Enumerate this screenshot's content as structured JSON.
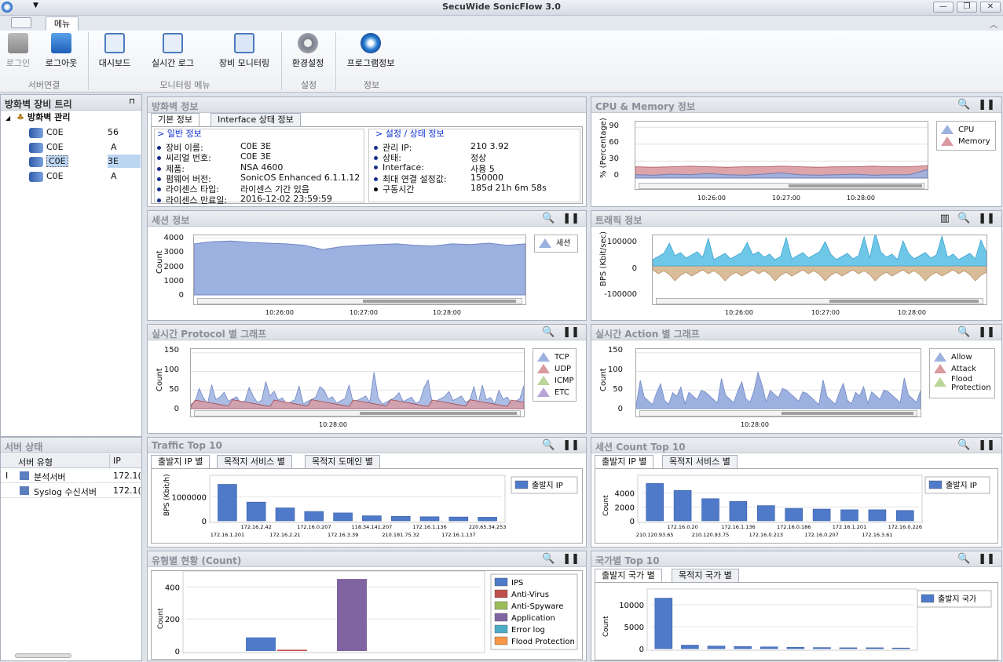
{
  "app": {
    "title": "SecuWide SonicFlow 3.0",
    "menu_tab": "메뉴"
  },
  "ribbon": {
    "buttons": [
      {
        "label": "로그인",
        "icon": "lock-gray-icon"
      },
      {
        "label": "로그아웃",
        "icon": "lock-blue-icon"
      },
      {
        "label": "대시보드",
        "icon": "dashboard-icon"
      },
      {
        "label": "실시간 로그",
        "icon": "chart-monitor-icon"
      },
      {
        "label": "장비 모니터링",
        "icon": "device-icon"
      },
      {
        "label": "환경설정",
        "icon": "gear-icon"
      },
      {
        "label": "프로그램정보",
        "icon": "info-globe-icon"
      }
    ],
    "groups": [
      "서버연결",
      "모니터링 메뉴",
      "설정",
      "정보"
    ]
  },
  "tree": {
    "title": "방화벽 장비 트리",
    "root": "방화벽 관리",
    "items": [
      {
        "name": "C0E",
        "suffix": "56"
      },
      {
        "name": "C0E",
        "suffix": "A"
      },
      {
        "name": "C0E",
        "suffix": "3E"
      },
      {
        "name": "C0E",
        "suffix": "A"
      }
    ]
  },
  "server_status": {
    "title": "서버 상태",
    "columns": [
      "서버 유형",
      "IP"
    ],
    "rows": [
      {
        "marker": "I",
        "type": "분석서버",
        "ip": "172.1("
      },
      {
        "marker": "",
        "type": "Syslog 수신서버",
        "ip": "172.1("
      }
    ]
  },
  "fw_info": {
    "title": "방화벽 정보",
    "tabs": [
      "기본 정보",
      "Interface 상태 정보"
    ],
    "general": {
      "heading": "> 일반 정보",
      "rows": [
        {
          "k": "장비 이름:",
          "v": "C0E      3E"
        },
        {
          "k": "씨리얼 번호:",
          "v": "C0E      3E"
        },
        {
          "k": "제품:",
          "v": "NSA 4600"
        },
        {
          "k": "펌웨어 버전:",
          "v": "SonicOS Enhanced 6.1.1.12"
        },
        {
          "k": "라이센스 타입:",
          "v": "라이센스 기간 있음"
        },
        {
          "k": "라이센스 만료일:",
          "v": "2016-12-02 23:59:59"
        }
      ]
    },
    "status": {
      "heading": "> 설정 / 상태 정보",
      "rows": [
        {
          "k": "관리 IP:",
          "v": "210       3.92"
        },
        {
          "k": "상태:",
          "v": "정상"
        },
        {
          "k": "Interface:",
          "v": "사용 5"
        },
        {
          "k": "최대 연결 설정값:",
          "v": "150000"
        },
        {
          "k": "구동시간",
          "v": "185d 21h 6m 58s"
        }
      ]
    }
  },
  "panels": {
    "cpu": "CPU & Memory 정보",
    "session": "세션 정보",
    "traffic": "트래픽 정보",
    "protocol": "실시간 Protocol 별 그래프",
    "action": "실시간 Action 별 그래프",
    "traffic_top": "Traffic Top 10",
    "session_top": "세션 Count Top 10",
    "type_count": "유형별 현황 (Count)",
    "country_top": "국가별 Top 10"
  },
  "time_labels": [
    "10:26:00",
    "10:27:00",
    "10:28:00"
  ],
  "chart_data": [
    {
      "id": "cpu",
      "type": "area",
      "ylabel": "% (Percentage)",
      "yticks": [
        "90",
        "60",
        "30",
        "0"
      ],
      "ylim": [
        0,
        100
      ],
      "legend": [
        {
          "name": "CPU",
          "color": "#9db1e0"
        },
        {
          "name": "Memory",
          "color": "#d99aa0"
        }
      ],
      "series": [
        {
          "name": "Memory",
          "values": [
            20,
            19,
            20,
            21,
            20,
            19,
            20,
            20,
            21,
            20,
            19,
            20,
            20,
            21,
            20,
            20,
            22
          ]
        },
        {
          "name": "CPU",
          "values": [
            6,
            5,
            7,
            6,
            8,
            6,
            5,
            7,
            9,
            6,
            5,
            6,
            7,
            5,
            6,
            6,
            15
          ]
        }
      ]
    },
    {
      "id": "session",
      "type": "area",
      "ylabel": "Count",
      "yticks": [
        "4000",
        "3000",
        "2000",
        "1000",
        "0"
      ],
      "ylim": [
        0,
        4200
      ],
      "legend": [
        {
          "name": "세션",
          "color": "#9db1e0"
        }
      ],
      "series": [
        {
          "name": "세션",
          "values": [
            3600,
            3750,
            3800,
            3700,
            3650,
            3600,
            3500,
            3200,
            3400,
            3500,
            3550,
            3600,
            3500,
            3450,
            3600,
            3550,
            3650,
            3500,
            3600
          ]
        }
      ]
    },
    {
      "id": "traffic",
      "type": "area",
      "ylabel": "BPS (Kbit/sec)",
      "yticks": [
        "100000",
        "0",
        "-100000"
      ],
      "ylim": [
        -130000,
        130000
      ]
    },
    {
      "id": "protocol",
      "type": "area",
      "ylabel": "Count",
      "yticks": [
        "150",
        "100",
        "50",
        "0"
      ],
      "ylim": [
        0,
        160
      ],
      "legend": [
        {
          "name": "TCP",
          "color": "#9db1e0"
        },
        {
          "name": "UDP",
          "color": "#d99aa0"
        },
        {
          "name": "ICMP",
          "color": "#bcd59a"
        },
        {
          "name": "ETC",
          "color": "#b7a4d6"
        }
      ]
    },
    {
      "id": "action",
      "type": "area",
      "ylabel": "Count",
      "yticks": [
        "150",
        "100",
        "50",
        "0"
      ],
      "ylim": [
        0,
        160
      ],
      "legend": [
        {
          "name": "Allow",
          "color": "#9db1e0"
        },
        {
          "name": "Attack",
          "color": "#d99aa0"
        },
        {
          "name": "Flood Protection",
          "color": "#bcd59a"
        }
      ]
    },
    {
      "id": "traffic_top",
      "type": "bar",
      "tabs": [
        "출발지 IP 별",
        "목적지 서비스 별",
        "목적지 도메인 별"
      ],
      "ylabel": "BPS (Kbit/h)",
      "yticks": [
        "1000000",
        "0"
      ],
      "ylim": [
        0,
        1700000
      ],
      "legend": [
        {
          "name": "출발지 IP",
          "color": "#4f79c9"
        }
      ],
      "categories": [
        "172.16.1.201",
        "172.16.2.42",
        "172.16.2.21",
        "172.16.0.207",
        "172.16.3.39",
        "118.34.141.207",
        "210.181.75.32",
        "172.16.1.136",
        "172.16.1.137",
        "220.65.34.253"
      ],
      "values": [
        1520000,
        780000,
        540000,
        390000,
        330000,
        210000,
        190000,
        170000,
        160000,
        150000
      ]
    },
    {
      "id": "session_top",
      "type": "bar",
      "tabs": [
        "출발지 IP 별",
        "목적지 서비스 별"
      ],
      "ylabel": "Count",
      "yticks": [
        "4000",
        "2000",
        "0"
      ],
      "ylim": [
        0,
        5900
      ],
      "legend": [
        {
          "name": "출발지 IP",
          "color": "#4f79c9"
        }
      ],
      "categories": [
        "210.120.93.65",
        "172.16.0.20",
        "210.120.93.75",
        "172.16.1.136",
        "172.16.0.213",
        "172.16.0.186",
        "172.16.0.207",
        "172.16.1.201",
        "172.16.3.61",
        "172.16.0.226"
      ],
      "values": [
        5400,
        4400,
        3200,
        2800,
        2200,
        1800,
        1700,
        1600,
        1600,
        1500
      ]
    },
    {
      "id": "type_count",
      "type": "bar",
      "ylabel": "Count",
      "yticks": [
        "400",
        "200",
        "0"
      ],
      "ylim": [
        0,
        470
      ],
      "legend": [
        {
          "name": "IPS",
          "color": "#4f79c9"
        },
        {
          "name": "Anti-Virus",
          "color": "#c0504d"
        },
        {
          "name": "Anti-Spyware",
          "color": "#9bbb59"
        },
        {
          "name": "Application",
          "color": "#8064a2"
        },
        {
          "name": "Error log",
          "color": "#4bacc6"
        },
        {
          "name": "Flood Protection",
          "color": "#f79646"
        }
      ],
      "values": [
        85,
        8,
        0,
        450,
        0,
        0
      ]
    },
    {
      "id": "country_top",
      "type": "bar",
      "tabs": [
        "출발지 국가 별",
        "목적지 국가 별"
      ],
      "ylabel": "Count",
      "yticks": [
        "10000",
        "5000",
        "0"
      ],
      "ylim": [
        0,
        12500
      ],
      "legend": [
        {
          "name": "출발지 국가",
          "color": "#4f79c9"
        }
      ],
      "values": [
        11500,
        800,
        600,
        500,
        400,
        300,
        250,
        200,
        200,
        150
      ]
    }
  ]
}
